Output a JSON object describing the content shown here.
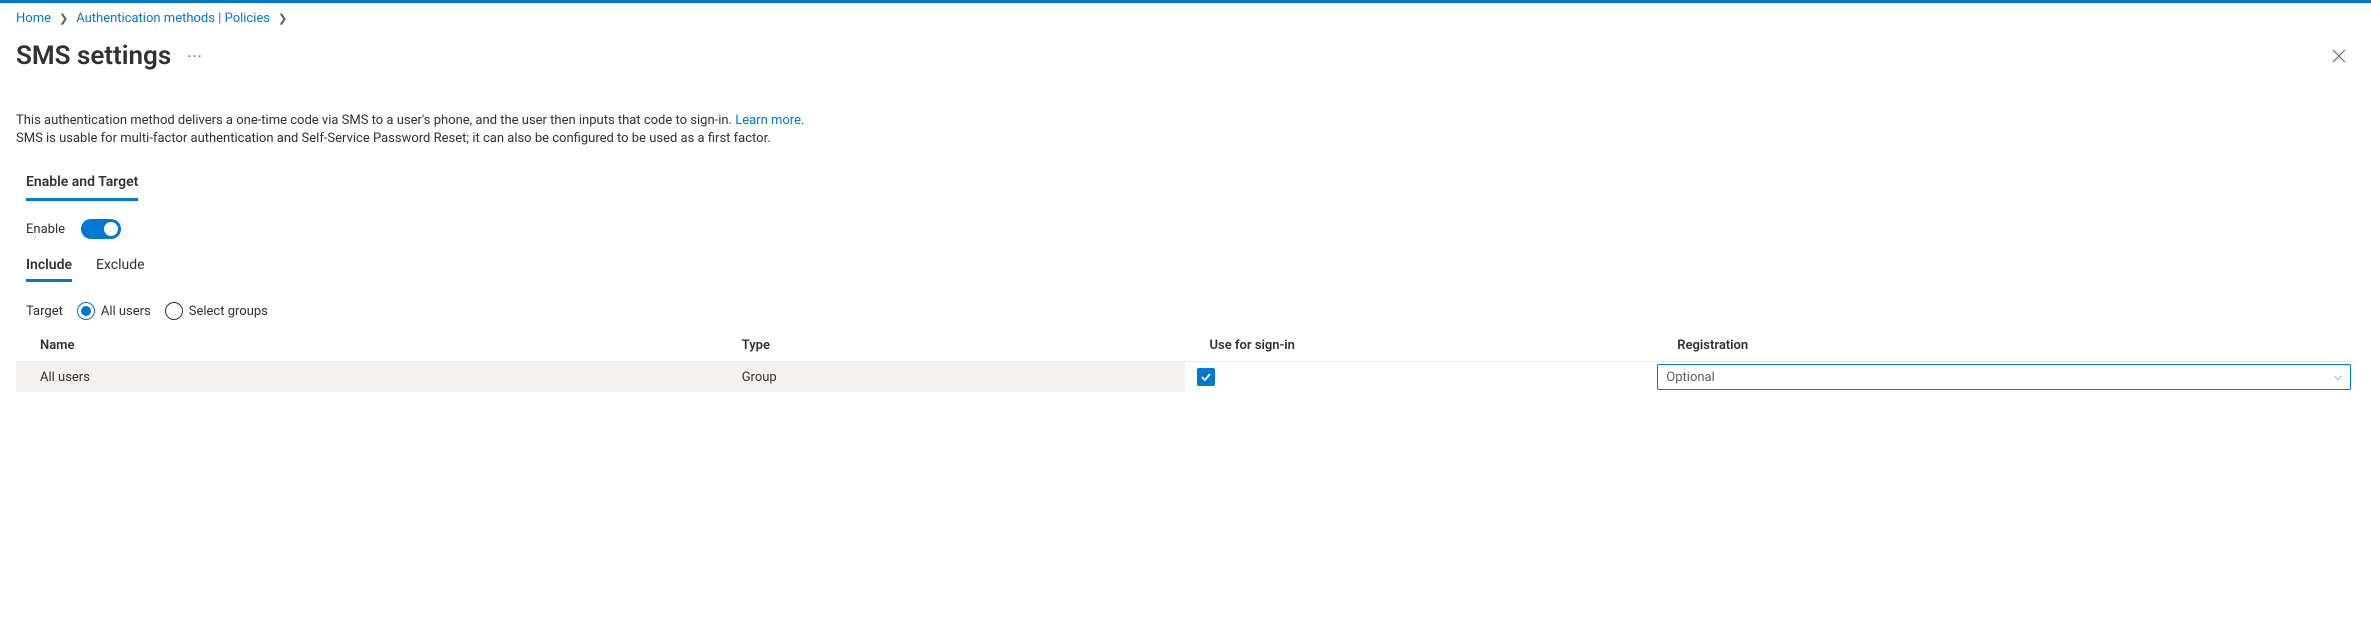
{
  "breadcrumb": {
    "home": "Home",
    "auth": "Authentication methods | Policies"
  },
  "title": "SMS settings",
  "description": {
    "line1_pre": "This authentication method delivers a one-time code via SMS to a user's phone, and the user then inputs that code to sign-in. ",
    "learn_more": "Learn more",
    "period": ".",
    "line2": "SMS is usable for multi-factor authentication and Self-Service Password Reset; it can also be configured to be used as a first factor."
  },
  "sections": {
    "enable_target": "Enable and Target"
  },
  "enable": {
    "label": "Enable"
  },
  "subtabs": {
    "include": "Include",
    "exclude": "Exclude"
  },
  "target": {
    "label": "Target",
    "all_users": "All users",
    "select_groups": "Select groups"
  },
  "table": {
    "headers": {
      "name": "Name",
      "type": "Type",
      "use_for_signin": "Use for sign-in",
      "registration": "Registration"
    },
    "row": {
      "name": "All users",
      "type": "Group",
      "registration_value": "Optional"
    }
  }
}
